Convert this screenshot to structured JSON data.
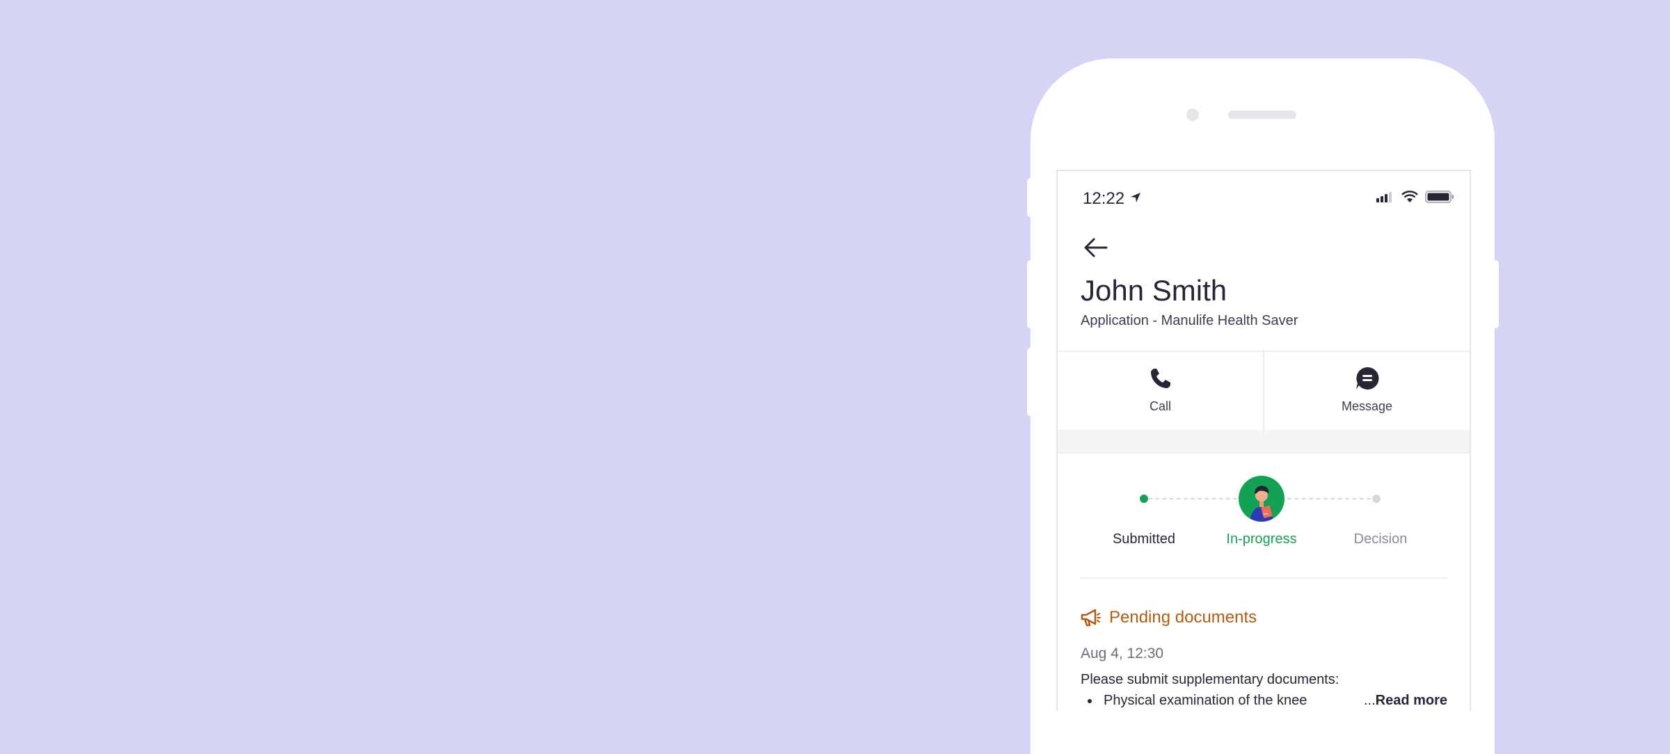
{
  "status_bar": {
    "time": "12:22"
  },
  "header": {
    "back_icon": "arrow-left-icon",
    "name": "John Smith",
    "subtitle": "Application - Manulife Health Saver"
  },
  "actions": [
    {
      "label": "Call",
      "icon": "phone-icon"
    },
    {
      "label": "Message",
      "icon": "chat-bubble-icon"
    }
  ],
  "progress": {
    "steps": [
      {
        "label": "Submitted",
        "state": "done"
      },
      {
        "label": "In-progress",
        "state": "current"
      },
      {
        "label": "Decision",
        "state": "upcoming"
      }
    ]
  },
  "pending": {
    "icon": "megaphone-icon",
    "title": "Pending documents",
    "date": "Aug 4, 12:30",
    "message": "Please submit supplementary documents:",
    "items": [
      "Physical examination of the knee"
    ],
    "read_more_prefix": "...",
    "read_more_label": "Read more"
  },
  "colors": {
    "background": "#d4d4f5",
    "accent_green": "#13a253",
    "warning_orange": "#b25c12",
    "text_primary": "#262637"
  }
}
